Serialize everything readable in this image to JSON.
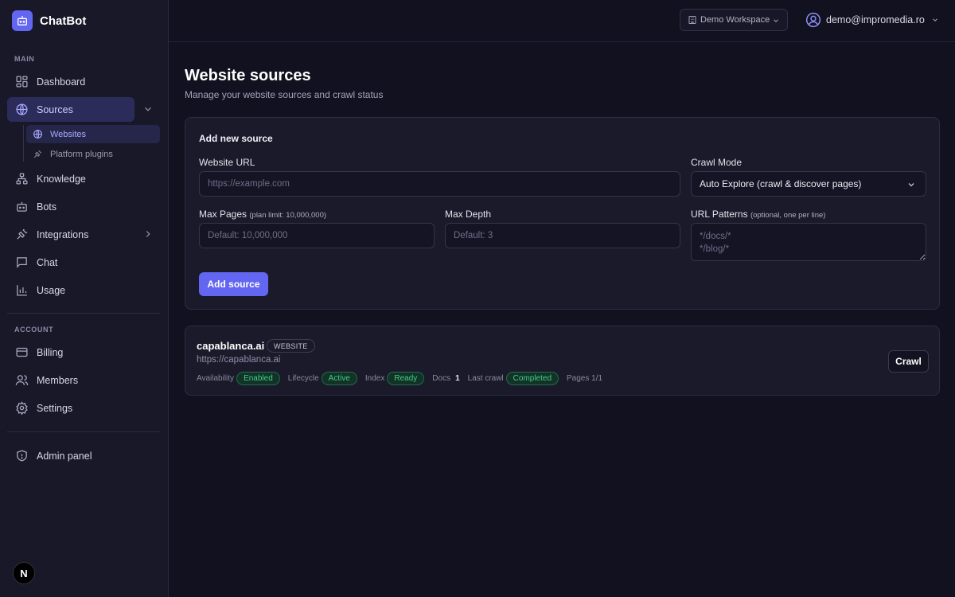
{
  "app": {
    "name": "ChatBot"
  },
  "sidebar": {
    "main_label": "MAIN",
    "account_label": "ACCOUNT",
    "items": {
      "dashboard": "Dashboard",
      "sources": "Sources",
      "websites": "Websites",
      "platform_plugins": "Platform plugins",
      "knowledge": "Knowledge",
      "bots": "Bots",
      "integrations": "Integrations",
      "chat": "Chat",
      "usage": "Usage",
      "billing": "Billing",
      "members": "Members",
      "settings": "Settings",
      "admin_panel": "Admin panel"
    },
    "footer_badge": "N"
  },
  "header": {
    "workspace": "Demo Workspace",
    "user_email": "demo@impromedia.ro"
  },
  "page": {
    "title": "Website sources",
    "subtitle": "Manage your website sources and crawl status"
  },
  "form": {
    "title": "Add new source",
    "url_label": "Website URL",
    "url_placeholder": "https://example.com",
    "crawl_mode_label": "Crawl Mode",
    "crawl_mode_value": "Auto Explore (crawl & discover pages)",
    "max_pages_label": "Max Pages",
    "max_pages_hint": "(plan limit: 10,000,000)",
    "max_pages_placeholder": "Default: 10,000,000",
    "max_depth_label": "Max Depth",
    "max_depth_placeholder": "Default: 3",
    "patterns_label": "URL Patterns",
    "patterns_hint": "(optional, one per line)",
    "patterns_placeholder": "*/docs/*\n*/blog/*",
    "submit_label": "Add source"
  },
  "sources": [
    {
      "name": "capablanca.ai",
      "type": "WEBSITE",
      "url": "https://capablanca.ai",
      "availability_label": "Availability",
      "availability": "Enabled",
      "lifecycle_label": "Lifecycle",
      "lifecycle": "Active",
      "index_label": "Index",
      "index": "Ready",
      "docs_label": "Docs",
      "docs": "1",
      "last_crawl_label": "Last crawl",
      "last_crawl": "Completed",
      "pages": "Pages 1/1",
      "action": "Crawl"
    }
  ],
  "colors": {
    "accent": "#6366f1",
    "success": "#3fcf8e",
    "background": "#11111f",
    "sidebar": "#181829"
  }
}
